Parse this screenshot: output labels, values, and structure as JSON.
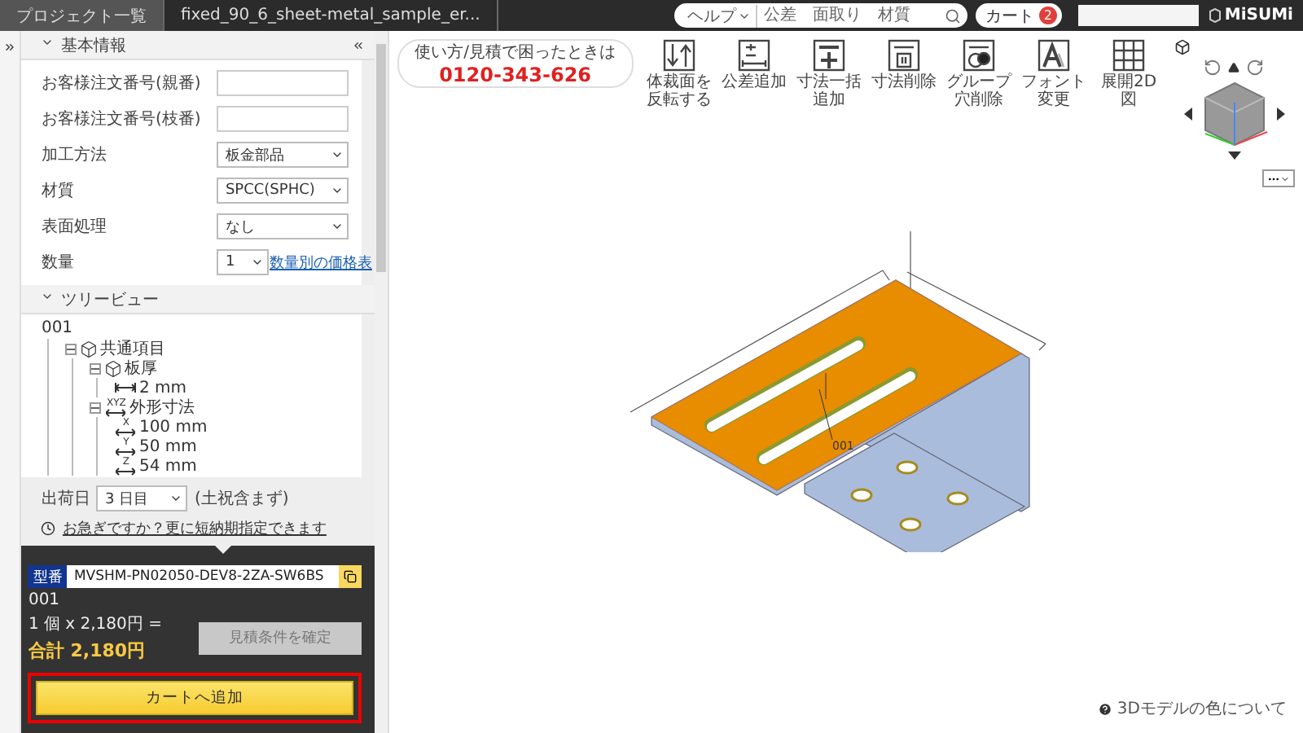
{
  "header": {
    "breadcrumbs": [
      {
        "label": "プロジェクト一覧"
      },
      {
        "label": "fixed_90_6_sheet-metal_sample_er..."
      }
    ],
    "search": {
      "scope": "ヘルプ",
      "placeholder": "公差　面取り　材質"
    },
    "cart": {
      "label": "カート",
      "count": "2"
    },
    "logo": "MiSUMi"
  },
  "sidebar": {
    "basic_info": {
      "title": "基本情報",
      "expanded": true,
      "fields": [
        {
          "label": "お客様注文番号(親番)",
          "kind": "text"
        },
        {
          "label": "お客様注文番号(枝番)",
          "kind": "text"
        },
        {
          "label": "加工方法",
          "kind": "select",
          "value": "板金部品"
        },
        {
          "label": "材質",
          "kind": "select",
          "value": "SPCC(SPHC)"
        },
        {
          "label": "表面処理",
          "kind": "select",
          "value": "なし"
        },
        {
          "label": "数量",
          "kind": "select_link",
          "value": "1",
          "link": "数量別の価格表"
        }
      ]
    },
    "tree_view": {
      "title": "ツリービュー",
      "expanded": true,
      "root": "001",
      "nodes": [
        {
          "label": "共通項目",
          "kind": "group",
          "expanded": true,
          "children": [
            {
              "label": "板厚",
              "kind": "group",
              "expanded": true,
              "children": [
                {
                  "label": "2 mm",
                  "kind": "thickness"
                }
              ]
            },
            {
              "label": "外形寸法",
              "kind": "dimensions",
              "axis": "XYZ",
              "expanded": true,
              "children": [
                {
                  "label": "100 mm",
                  "kind": "dimension",
                  "axis": "X"
                },
                {
                  "label": "50 mm",
                  "kind": "dimension",
                  "axis": "Y"
                },
                {
                  "label": "54 mm",
                  "kind": "dimension",
                  "axis": "Z"
                }
              ]
            }
          ]
        }
      ]
    },
    "shipping": {
      "label": "出荷日",
      "value": "3 日目",
      "note": "(土祝含まず)",
      "link": "お急ぎですか？更に短納期指定できます"
    }
  },
  "order": {
    "part_label": "型番",
    "part_number": "MVSHM-PN02050-DEV8-2ZA-SW6BS",
    "item": "001",
    "unit_price": "1 個  x 2,180円 =",
    "total": "合計 2,180円",
    "confirm_button": {
      "label": "見積条件を確定",
      "disabled": true
    },
    "cart_button": {
      "label": "カートへ追加",
      "highlighted": true
    }
  },
  "viewer": {
    "support": {
      "caption": "使い方/見積で困ったときは",
      "phone": "0120-343-626"
    },
    "tools": [
      {
        "label": "体裁面を反転する",
        "kind": "flip"
      },
      {
        "label": "公差追加",
        "kind": "tolerance"
      },
      {
        "label": "寸法一括追加",
        "kind": "pmi_add"
      },
      {
        "label": "寸法削除",
        "kind": "pmi_delete"
      },
      {
        "label": "グループ穴削除",
        "kind": "split"
      },
      {
        "label": "フォント変更",
        "kind": "font"
      },
      {
        "label": "展開2D図",
        "kind": "unfold"
      }
    ],
    "model_label": "001",
    "color_help": "3Dモデルの色について"
  }
}
